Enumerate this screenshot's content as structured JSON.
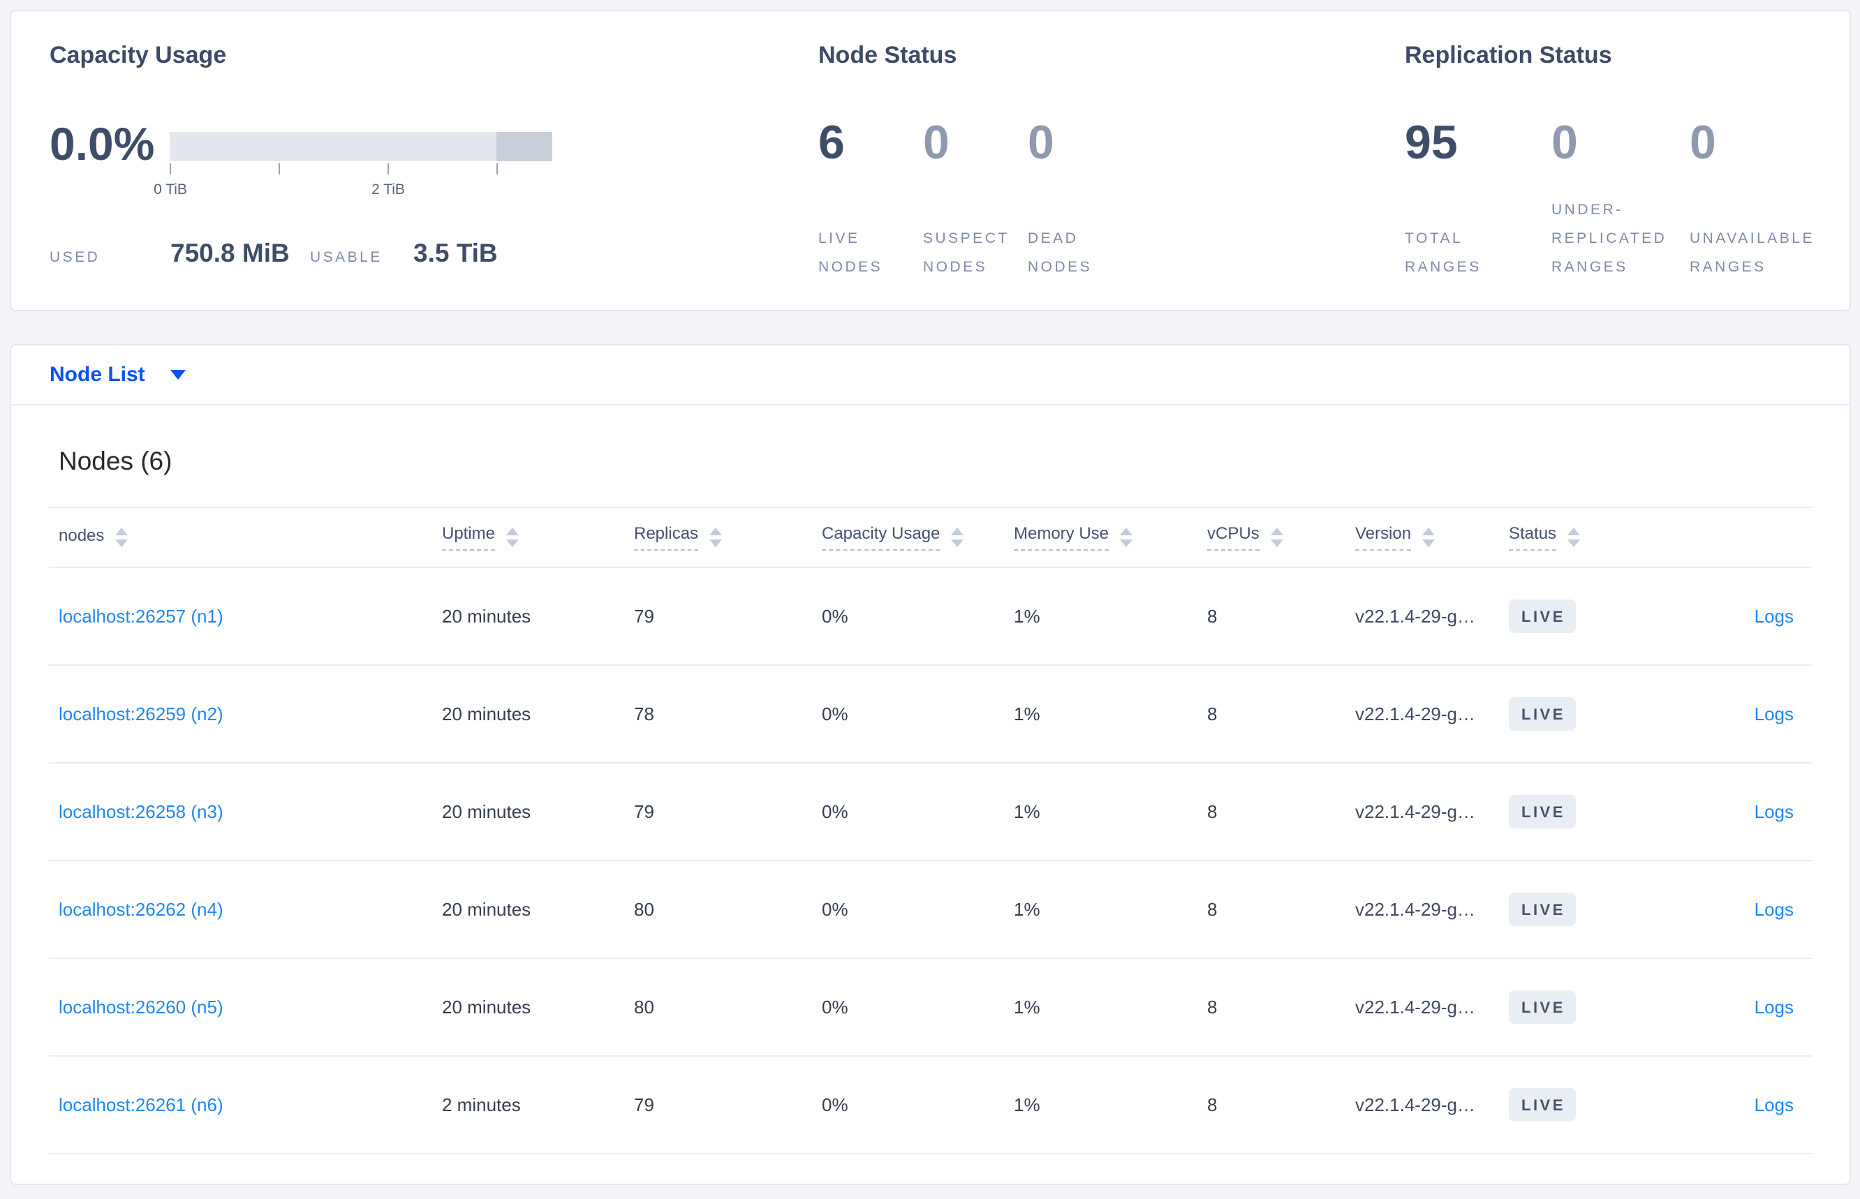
{
  "colors": {
    "nav_blue": "#0b53f0",
    "link_blue": "#1e87f2",
    "stat_dark": "#3e4d68",
    "stat_muted": "#8f9ab1",
    "badge_bg": "#e9edf4",
    "bar_light": "#e4e7ee",
    "bar_dark": "#c9cfd9"
  },
  "panels": {
    "capacity": {
      "title": "Capacity Usage",
      "percent": "0.0%",
      "tick_labels": [
        "0 TiB",
        "2 TiB"
      ],
      "used_label": "USED",
      "used_value": "750.8 MiB",
      "usable_label": "USABLE",
      "usable_value": "3.5 TiB"
    },
    "node_status": {
      "title": "Node Status",
      "stats": [
        {
          "value": "6",
          "label": "LIVE NODES"
        },
        {
          "value": "0",
          "label": "SUSPECT NODES"
        },
        {
          "value": "0",
          "label": "DEAD NODES"
        }
      ]
    },
    "replication": {
      "title": "Replication Status",
      "stats": [
        {
          "value": "95",
          "label": "TOTAL RANGES"
        },
        {
          "value": "0",
          "label": "UNDER-REPLICATED RANGES"
        },
        {
          "value": "0",
          "label": "UNAVAILABLE RANGES"
        }
      ]
    }
  },
  "nav": {
    "view_selector_label": "Node List"
  },
  "table": {
    "heading": "Nodes (6)",
    "columns": [
      {
        "label": "nodes",
        "dashed": false
      },
      {
        "label": "Uptime",
        "dashed": true
      },
      {
        "label": "Replicas",
        "dashed": true
      },
      {
        "label": "Capacity Usage",
        "dashed": true
      },
      {
        "label": "Memory Use",
        "dashed": true
      },
      {
        "label": "vCPUs",
        "dashed": true
      },
      {
        "label": "Version",
        "dashed": true
      },
      {
        "label": "Status",
        "dashed": true
      }
    ],
    "rows": [
      {
        "node": "localhost:26257 (n1)",
        "uptime": "20 minutes",
        "replicas": "79",
        "capacity": "0%",
        "memory": "1%",
        "vcpus": "8",
        "version": "v22.1.4-29-g…",
        "status": "LIVE",
        "logs": "Logs"
      },
      {
        "node": "localhost:26259 (n2)",
        "uptime": "20 minutes",
        "replicas": "78",
        "capacity": "0%",
        "memory": "1%",
        "vcpus": "8",
        "version": "v22.1.4-29-g…",
        "status": "LIVE",
        "logs": "Logs"
      },
      {
        "node": "localhost:26258 (n3)",
        "uptime": "20 minutes",
        "replicas": "79",
        "capacity": "0%",
        "memory": "1%",
        "vcpus": "8",
        "version": "v22.1.4-29-g…",
        "status": "LIVE",
        "logs": "Logs"
      },
      {
        "node": "localhost:26262 (n4)",
        "uptime": "20 minutes",
        "replicas": "80",
        "capacity": "0%",
        "memory": "1%",
        "vcpus": "8",
        "version": "v22.1.4-29-g…",
        "status": "LIVE",
        "logs": "Logs"
      },
      {
        "node": "localhost:26260 (n5)",
        "uptime": "20 minutes",
        "replicas": "80",
        "capacity": "0%",
        "memory": "1%",
        "vcpus": "8",
        "version": "v22.1.4-29-g…",
        "status": "LIVE",
        "logs": "Logs"
      },
      {
        "node": "localhost:26261 (n6)",
        "uptime": "2 minutes",
        "replicas": "79",
        "capacity": "0%",
        "memory": "1%",
        "vcpus": "8",
        "version": "v22.1.4-29-g…",
        "status": "LIVE",
        "logs": "Logs"
      }
    ]
  }
}
